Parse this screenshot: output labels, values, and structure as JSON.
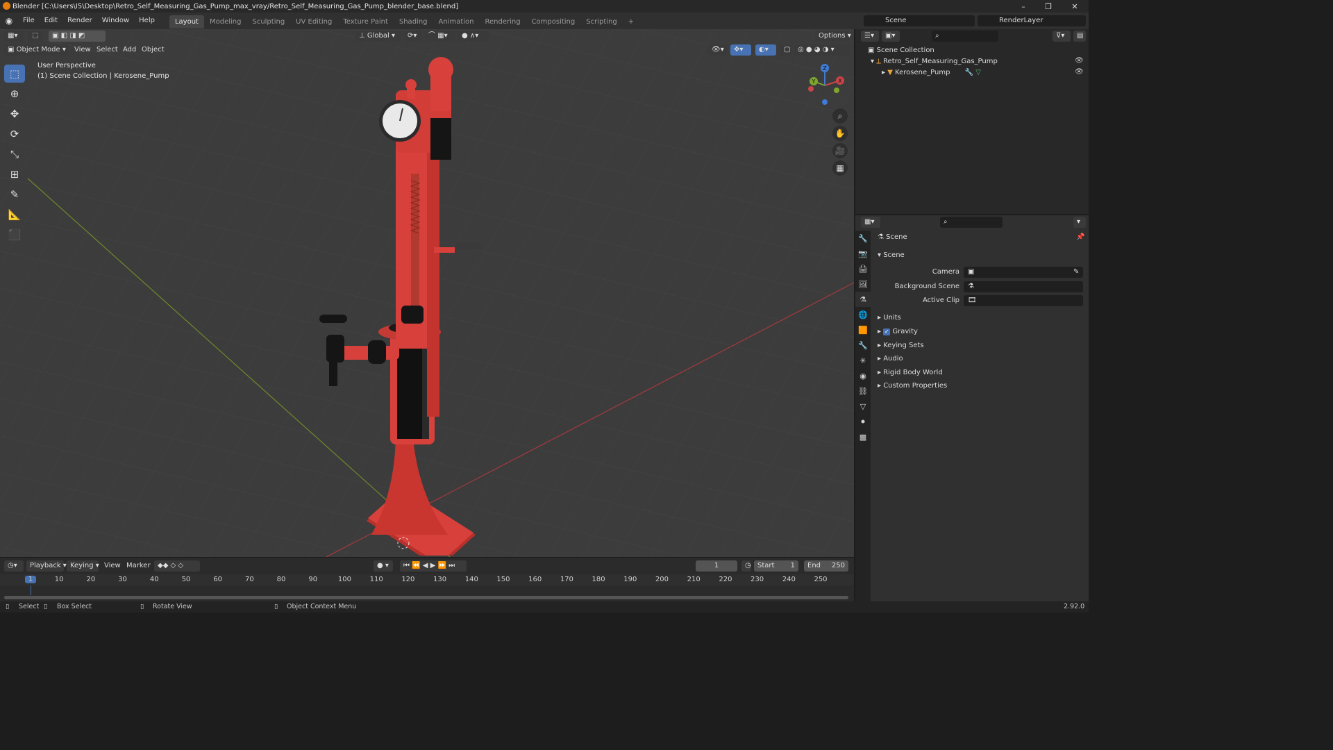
{
  "window": {
    "title": "Blender [C:\\Users\\I5\\Desktop\\Retro_Self_Measuring_Gas_Pump_max_vray/Retro_Self_Measuring_Gas_Pump_blender_base.blend]",
    "minimize": "–",
    "maximize": "❐",
    "close": "✕"
  },
  "menu": [
    "File",
    "Edit",
    "Render",
    "Window",
    "Help"
  ],
  "workspaces": [
    "Layout",
    "Modeling",
    "Sculpting",
    "UV Editing",
    "Texture Paint",
    "Shading",
    "Animation",
    "Rendering",
    "Compositing",
    "Scripting"
  ],
  "workspace_add": "+",
  "scene_selector": "Scene",
  "view_layer_selector": "RenderLayer",
  "viewport": {
    "transform_orientation": "Global",
    "options_label": "Options",
    "mode": "Object Mode",
    "header_menus": [
      "View",
      "Select",
      "Add",
      "Object"
    ],
    "overlay_line1": "User Perspective",
    "overlay_line2": "(1) Scene Collection | Kerosene_Pump",
    "axes": {
      "x": "X",
      "y": "Y",
      "z": "Z"
    }
  },
  "outliner": {
    "root": "Scene Collection",
    "items": [
      {
        "name": "Retro_Self_Measuring_Gas_Pump"
      },
      {
        "name": "Kerosene_Pump"
      }
    ]
  },
  "properties": {
    "context_label": "Scene",
    "panel_title": "Scene",
    "fields": [
      {
        "label": "Camera"
      },
      {
        "label": "Background Scene"
      },
      {
        "label": "Active Clip"
      }
    ],
    "subpanels": [
      "Units",
      "Gravity",
      "Keying Sets",
      "Audio",
      "Rigid Body World",
      "Custom Properties"
    ],
    "gravity_checked": true
  },
  "timeline": {
    "menus": [
      "Playback",
      "Keying",
      "View",
      "Marker"
    ],
    "current_frame": "1",
    "start_label": "Start",
    "start_value": "1",
    "end_label": "End",
    "end_value": "250",
    "ruler": [
      "1",
      "10",
      "20",
      "30",
      "40",
      "50",
      "60",
      "70",
      "80",
      "90",
      "100",
      "110",
      "120",
      "130",
      "140",
      "150",
      "160",
      "170",
      "180",
      "190",
      "200",
      "210",
      "220",
      "230",
      "240",
      "250"
    ]
  },
  "status": {
    "select": "Select",
    "box_select": "Box Select",
    "rotate_view": "Rotate View",
    "context_menu": "Object Context Menu",
    "version": "2.92.0"
  },
  "colors": {
    "accent": "#4772b3",
    "pump_red": "#d8413b",
    "axis_x": "#c9454a",
    "axis_y": "#7ea52f",
    "axis_z": "#3f7ad6",
    "logo": "#e87d0d"
  }
}
